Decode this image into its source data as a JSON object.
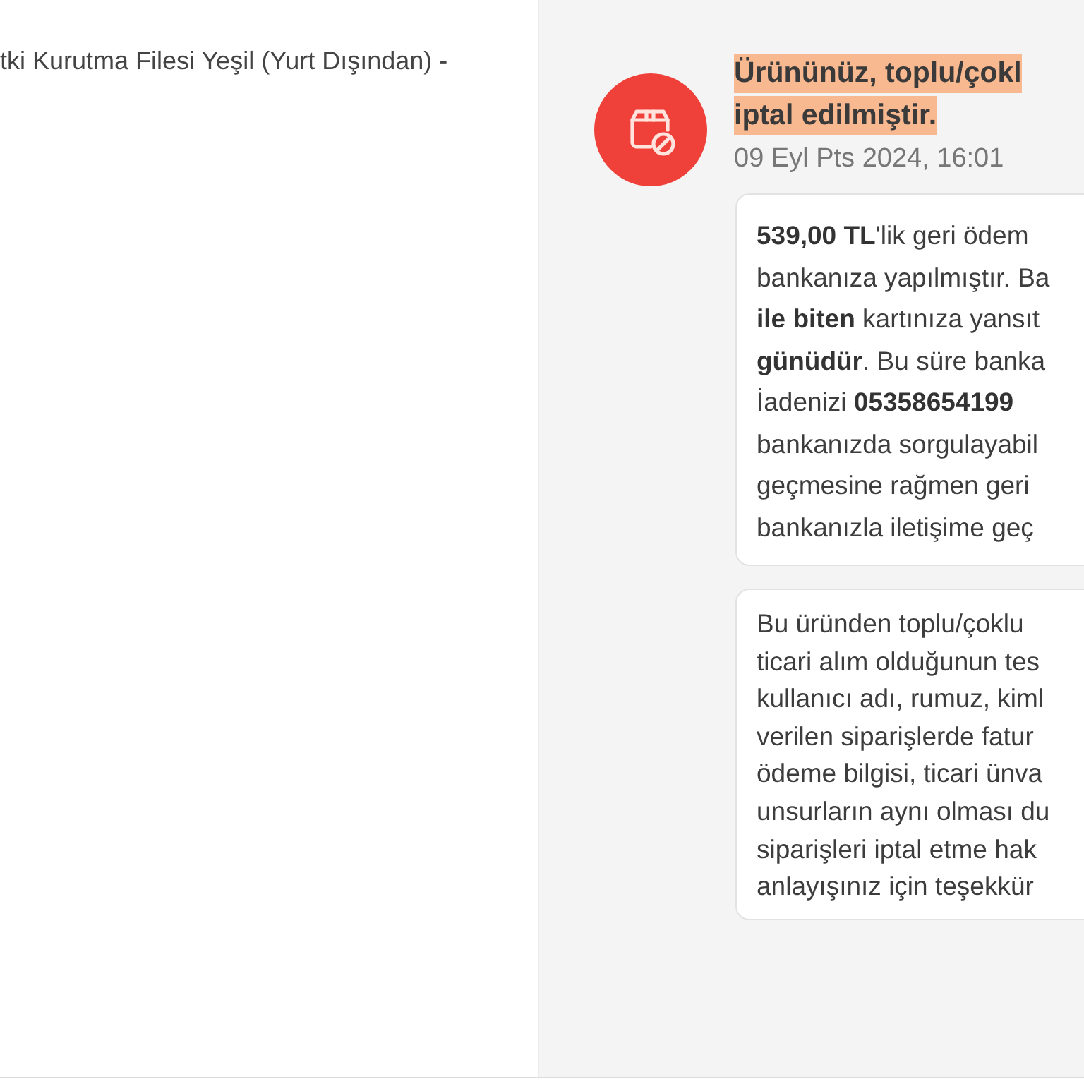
{
  "product_panel": {
    "title_fragment": "tki Kurutma Filesi Yeşil (Yurt Dışından) -"
  },
  "notification": {
    "title_lines": [
      "Ürününüz, toplu/çokl",
      "iptal edilmiştir."
    ],
    "highlighted": true,
    "timestamp": "09 Eyl Pts 2024, 16:01",
    "messages": [
      {
        "lines": [
          "**539,00 TL**'lik geri ödem",
          "bankanıza yapılmıştır. Ba",
          "**ile biten** kartınıza yansıt",
          "**günüdür**. Bu süre banka",
          "İadenizi **05358654199**",
          "bankanızda sorgulayabil",
          "geçmesine rağmen geri",
          "bankanızla iletişime geç"
        ]
      },
      {
        "lines": [
          "Bu üründen toplu/çoklu",
          "ticari alım olduğunun tes",
          "kullanıcı adı, rumuz, kiml",
          "verilen siparişlerde fatur",
          "ödeme bilgisi, ticari ünva",
          "unsurların aynı olması du",
          "siparişleri iptal etme hak",
          "anlayışınız için teşekkür"
        ]
      }
    ]
  }
}
